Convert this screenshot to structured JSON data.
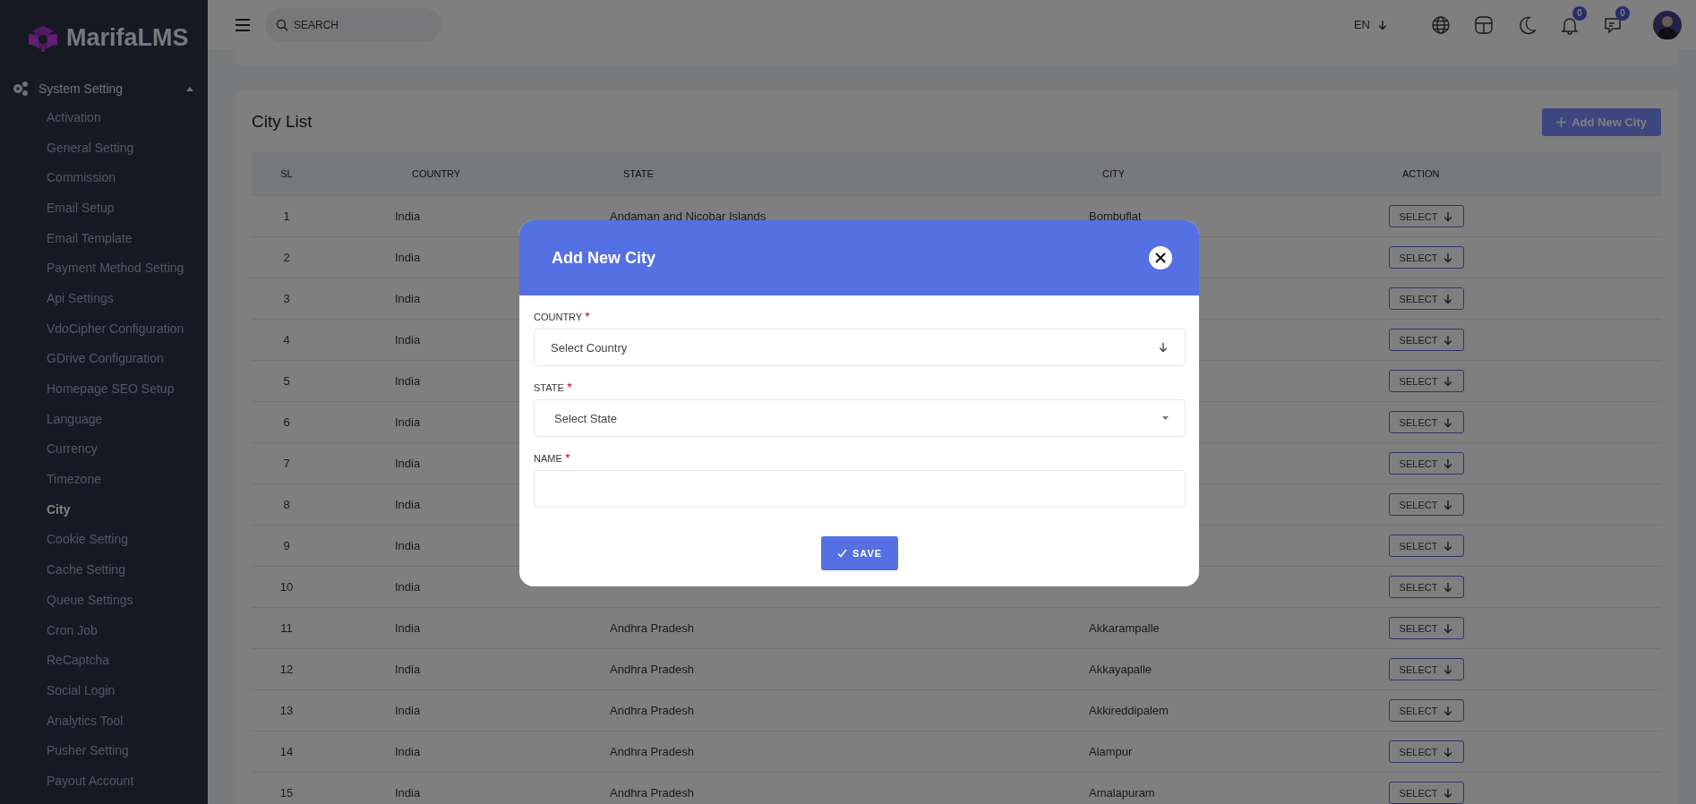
{
  "brand": {
    "name": "MarifaLMS"
  },
  "sidebar": {
    "section": {
      "label": "System Setting",
      "expanded": true
    },
    "items": [
      {
        "label": "Activation",
        "selected": false
      },
      {
        "label": "General Setting",
        "selected": false
      },
      {
        "label": "Commission",
        "selected": false
      },
      {
        "label": "Email Setup",
        "selected": false
      },
      {
        "label": "Email Template",
        "selected": false
      },
      {
        "label": "Payment Method Setting",
        "selected": false
      },
      {
        "label": "Api Settings",
        "selected": false
      },
      {
        "label": "VdoCipher Configuration",
        "selected": false
      },
      {
        "label": "GDrive Configuration",
        "selected": false
      },
      {
        "label": "Homepage SEO Setup",
        "selected": false
      },
      {
        "label": "Language",
        "selected": false
      },
      {
        "label": "Currency",
        "selected": false
      },
      {
        "label": "Timezone",
        "selected": false
      },
      {
        "label": "City",
        "selected": true
      },
      {
        "label": "Cookie Setting",
        "selected": false
      },
      {
        "label": "Cache Setting",
        "selected": false
      },
      {
        "label": "Queue Settings",
        "selected": false
      },
      {
        "label": "Cron Job",
        "selected": false
      },
      {
        "label": "ReCaptcha",
        "selected": false
      },
      {
        "label": "Social Login",
        "selected": false
      },
      {
        "label": "Analytics Tool",
        "selected": false
      },
      {
        "label": "Pusher Setting",
        "selected": false
      },
      {
        "label": "Payout Account",
        "selected": false
      }
    ]
  },
  "topbar": {
    "search": {
      "placeholder": "SEARCH"
    },
    "language": "EN",
    "notifications": "0",
    "messages": "0"
  },
  "city_list": {
    "title": "City List",
    "add_button": "Add New City",
    "columns": [
      "SL",
      "COUNTRY",
      "STATE",
      "CITY",
      "ACTION"
    ],
    "rows": [
      {
        "sl": "1",
        "country": "India",
        "state": "Andaman and Nicobar Islands",
        "city": "Bombuflat",
        "action": "SELECT"
      },
      {
        "sl": "2",
        "country": "India",
        "action": "SELECT"
      },
      {
        "sl": "3",
        "country": "India",
        "action": "SELECT"
      },
      {
        "sl": "4",
        "country": "India",
        "action": "SELECT"
      },
      {
        "sl": "5",
        "country": "India",
        "action": "SELECT"
      },
      {
        "sl": "6",
        "country": "India",
        "action": "SELECT"
      },
      {
        "sl": "7",
        "country": "India",
        "action": "SELECT"
      },
      {
        "sl": "8",
        "country": "India",
        "action": "SELECT"
      },
      {
        "sl": "9",
        "country": "India",
        "action": "SELECT"
      },
      {
        "sl": "10",
        "country": "India",
        "action": "SELECT"
      },
      {
        "sl": "11",
        "country": "India",
        "state": "Andhra Pradesh",
        "city": "Akkarampalle",
        "action": "SELECT"
      },
      {
        "sl": "12",
        "country": "India",
        "state": "Andhra Pradesh",
        "city": "Akkayapalle",
        "action": "SELECT"
      },
      {
        "sl": "13",
        "country": "India",
        "state": "Andhra Pradesh",
        "city": "Akkireddipalem",
        "action": "SELECT"
      },
      {
        "sl": "14",
        "country": "India",
        "state": "Andhra Pradesh",
        "city": "Alampur",
        "action": "SELECT"
      },
      {
        "sl": "15",
        "country": "India",
        "state": "Andhra Pradesh",
        "city": "Amalapuram",
        "action": "SELECT"
      }
    ]
  },
  "modal": {
    "title": "Add New City",
    "fields": [
      {
        "label": "COUNTRY",
        "required": true,
        "kind": "select-arrow",
        "placeholder": "Select Country"
      },
      {
        "label": "STATE",
        "required": true,
        "kind": "select-caret",
        "placeholder": "Select State"
      },
      {
        "label": "NAME",
        "required": true,
        "kind": "text"
      }
    ],
    "submit": "SAVE"
  }
}
